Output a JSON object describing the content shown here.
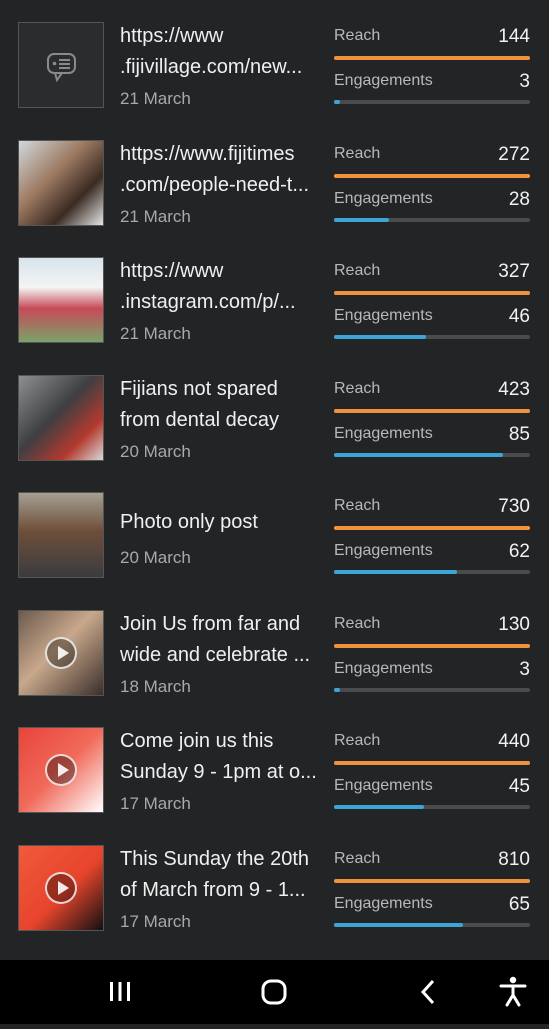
{
  "colors": {
    "reach": "#f2913b",
    "engagements": "#3ea4d6",
    "track": "#4a4b4e"
  },
  "metric_labels": {
    "reach": "Reach",
    "engagements": "Engagements"
  },
  "posts": [
    {
      "title_lines": [
        "https://www",
        ".fijivillage.com/new..."
      ],
      "date": "21 March",
      "reach": 144,
      "engagements": 3,
      "reach_fill": 1.0,
      "eng_fill": 0.03,
      "thumb": "placeholder-icon"
    },
    {
      "title_lines": [
        "https://www.fijitimes",
        ".com/people-need-t..."
      ],
      "date": "21 March",
      "reach": 272,
      "engagements": 28,
      "reach_fill": 1.0,
      "eng_fill": 0.28,
      "thumb": "photo"
    },
    {
      "title_lines": [
        "https://www",
        ".instagram.com/p/..."
      ],
      "date": "21 March",
      "reach": 327,
      "engagements": 46,
      "reach_fill": 1.0,
      "eng_fill": 0.47,
      "thumb": "photo"
    },
    {
      "title_lines": [
        "Fijians not spared",
        "from dental decay"
      ],
      "date": "20 March",
      "reach": 423,
      "engagements": 85,
      "reach_fill": 1.0,
      "eng_fill": 0.86,
      "thumb": "photo"
    },
    {
      "title_lines": [
        "Photo only post"
      ],
      "date": "20 March",
      "reach": 730,
      "engagements": 62,
      "reach_fill": 1.0,
      "eng_fill": 0.63,
      "thumb": "photo"
    },
    {
      "title_lines": [
        "Join Us from far and",
        "wide and celebrate ..."
      ],
      "date": "18 March",
      "reach": 130,
      "engagements": 3,
      "reach_fill": 1.0,
      "eng_fill": 0.03,
      "thumb": "video"
    },
    {
      "title_lines": [
        "Come join us this",
        "Sunday 9 - 1pm at o..."
      ],
      "date": "17 March",
      "reach": 440,
      "engagements": 45,
      "reach_fill": 1.0,
      "eng_fill": 0.46,
      "thumb": "video"
    },
    {
      "title_lines": [
        "This Sunday the 20th",
        "of March from 9 - 1..."
      ],
      "date": "17 March",
      "reach": 810,
      "engagements": 65,
      "reach_fill": 1.0,
      "eng_fill": 0.66,
      "thumb": "video"
    }
  ],
  "navbar": {
    "recents": "recents-icon",
    "home": "home-icon",
    "back": "back-icon",
    "accessibility": "accessibility-icon"
  }
}
